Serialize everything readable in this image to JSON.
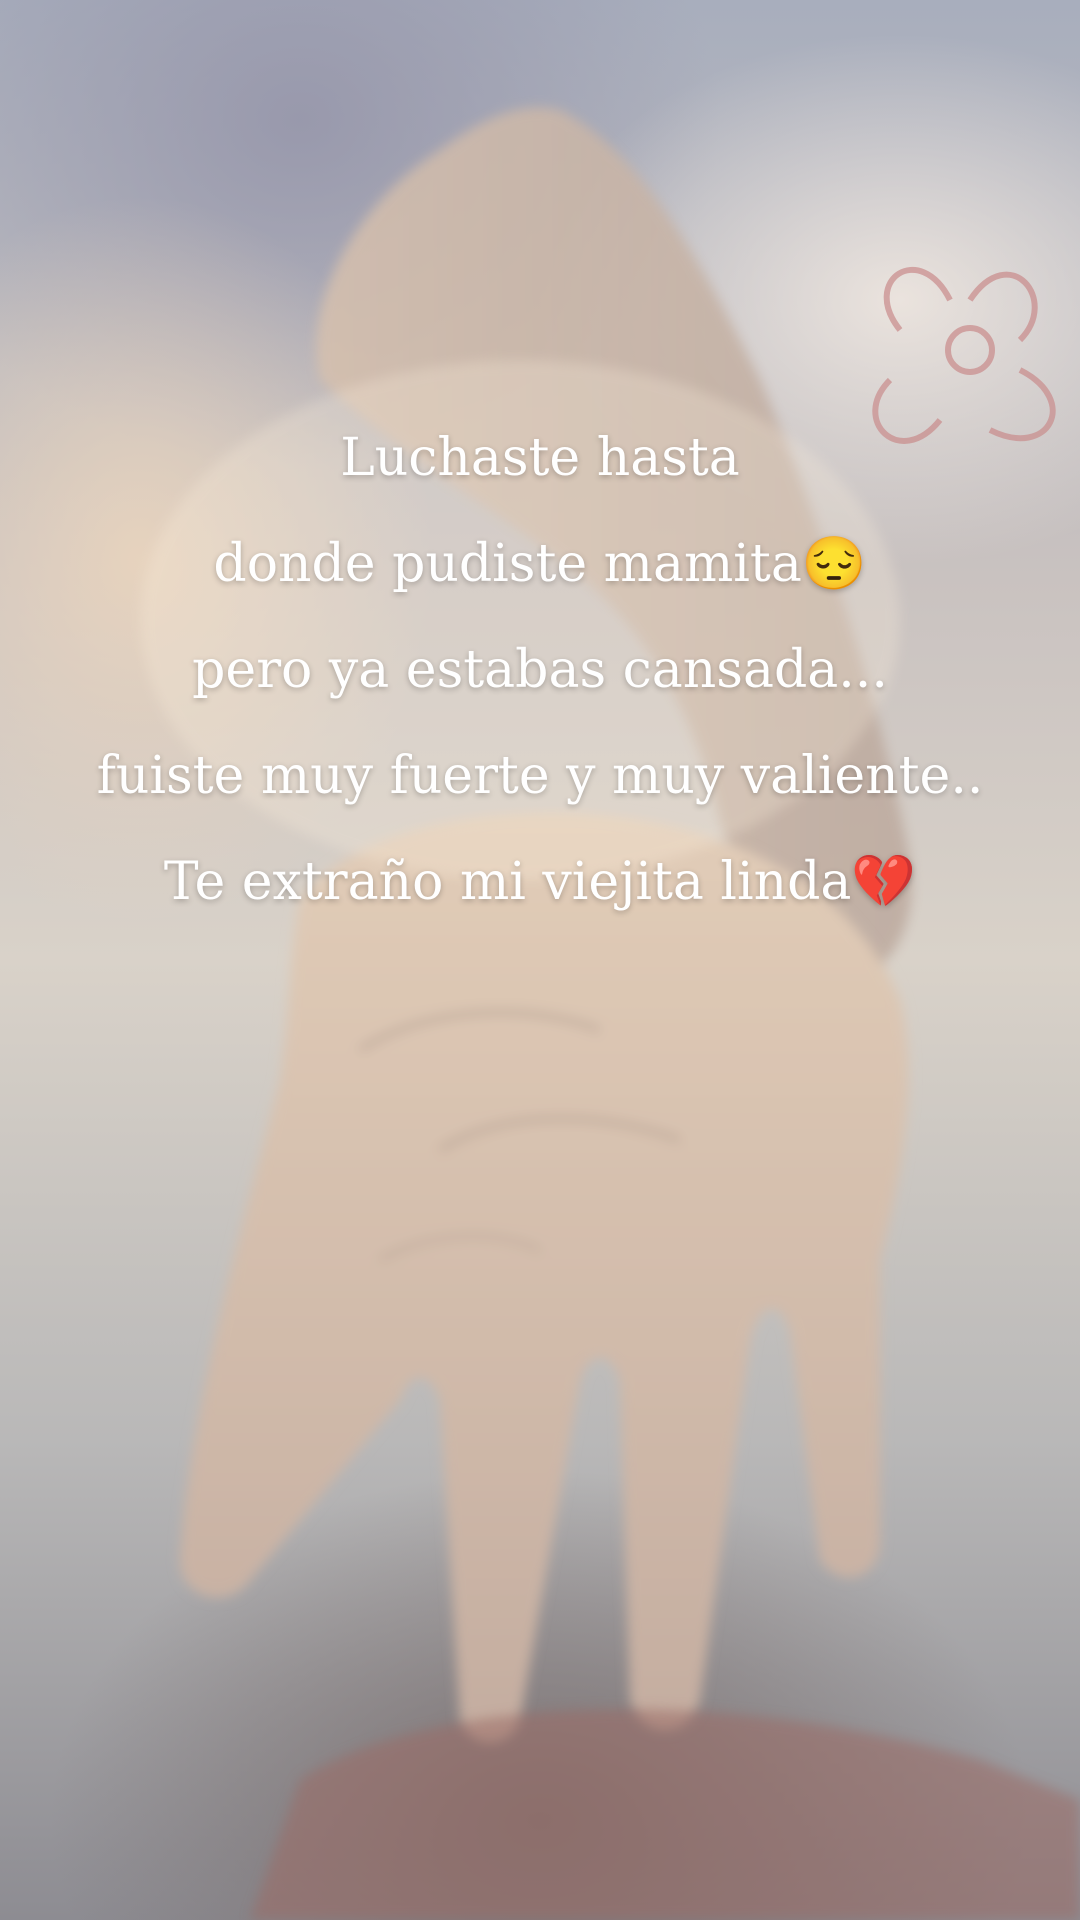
{
  "caption": {
    "lines": [
      "Luchaste  hasta",
      "donde pudiste mamita😔",
      "pero ya estabas cansada...",
      "fuiste muy fuerte y muy valiente..",
      "Te extraño mi viejita linda💔"
    ]
  },
  "photo": {
    "subject": "elderly hand held by another hand, double-exposed over soft floral background",
    "colors": {
      "skin": "#d8c2ad",
      "skin_shadow": "#a9958a",
      "flower_outline": "#c98b8b",
      "background_top": "#a8aebd",
      "background_bottom": "#8d8c92"
    }
  }
}
